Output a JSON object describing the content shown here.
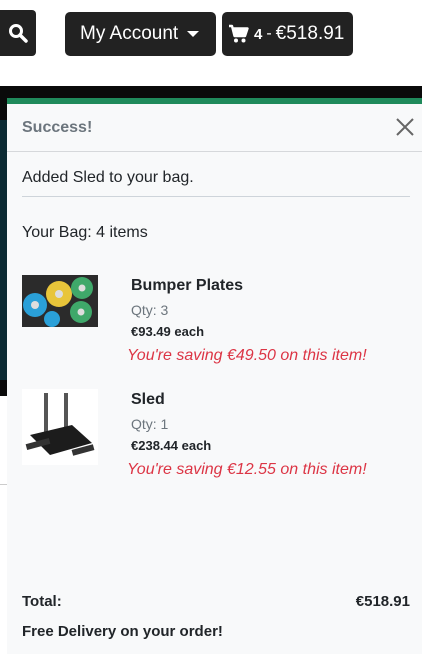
{
  "navbar": {
    "search_icon": "search-icon",
    "account_label": "My Account",
    "bag": {
      "icon": "shopping-cart-icon",
      "count": "4",
      "separator": "-",
      "total": "€518.91"
    }
  },
  "toast": {
    "title": "Success!",
    "close_icon": "close-icon",
    "message": "Added Sled to your bag.",
    "bag_summary": "Your Bag: 4 items",
    "items": [
      {
        "name": "Bumper Plates",
        "qty": "Qty: 3",
        "price": "€93.49 each",
        "saving": "You're saving €49.50 on this item!",
        "image": "bumper-plates-image"
      },
      {
        "name": "Sled",
        "qty": "Qty: 1",
        "price": "€238.44 each",
        "saving": "You're saving €12.55 on this item!",
        "image": "sled-image"
      }
    ],
    "total_label": "Total:",
    "total_value": "€518.91",
    "delivery_note": "Free Delivery on your order!"
  },
  "colors": {
    "toast_accent": "#1f8a5b",
    "saving_text": "#dc3545",
    "button_bg": "#222222"
  }
}
